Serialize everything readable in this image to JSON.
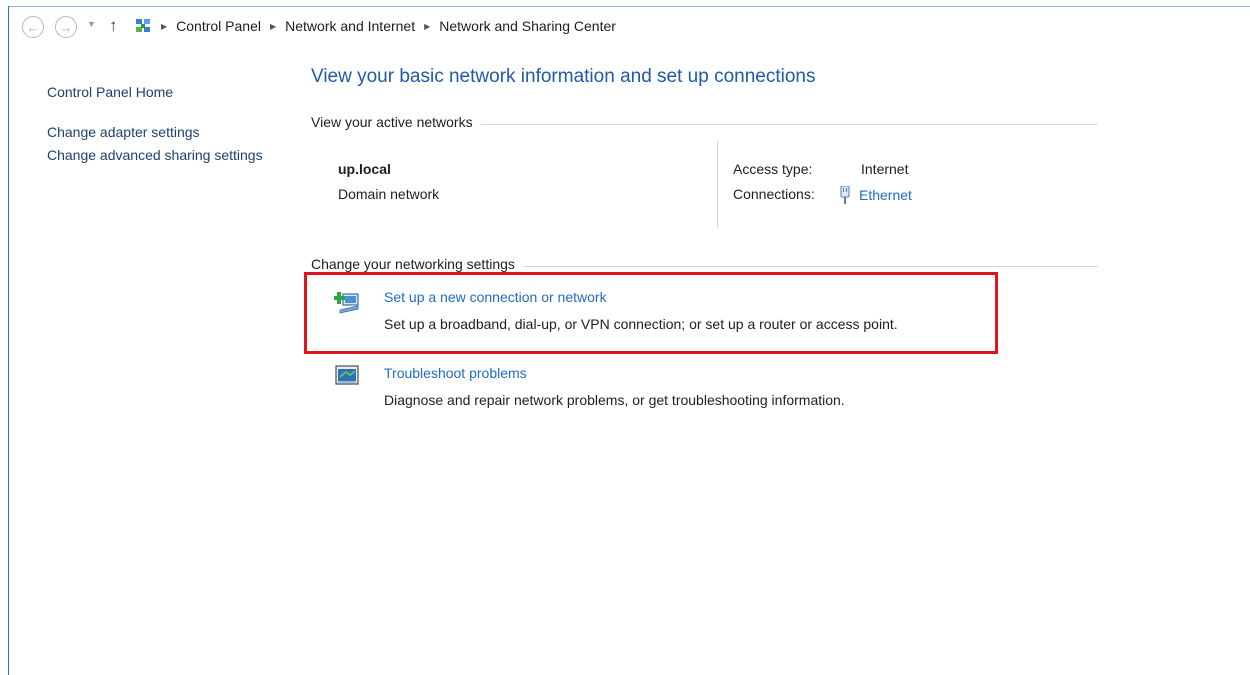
{
  "breadcrumb": [
    "Control Panel",
    "Network and Internet",
    "Network and Sharing Center"
  ],
  "left_pane": {
    "home": "Control Panel Home",
    "adapter": "Change adapter settings",
    "advanced_sharing": "Change advanced sharing settings"
  },
  "main": {
    "title": "View your basic network information and set up connections",
    "active_networks_label": "View your active networks",
    "network": {
      "name": "up.local",
      "type": "Domain network",
      "access_type_label": "Access type:",
      "access_type_value": "Internet",
      "connections_label": "Connections:",
      "connections_value": "Ethernet"
    },
    "change_settings_label": "Change your networking settings",
    "tasks": [
      {
        "link": "Set up a new connection or network",
        "description": "Set up a broadband, dial-up, or VPN connection; or set up a router or access point.",
        "icon": "new-connection-icon"
      },
      {
        "link": "Troubleshoot problems",
        "description": "Diagnose and repair network problems, or get troubleshooting information.",
        "icon": "troubleshoot-icon"
      }
    ]
  },
  "colors": {
    "title_blue": "#1e5aa8",
    "link_blue": "#1e6dc8",
    "highlight_red": "#e0141e"
  }
}
